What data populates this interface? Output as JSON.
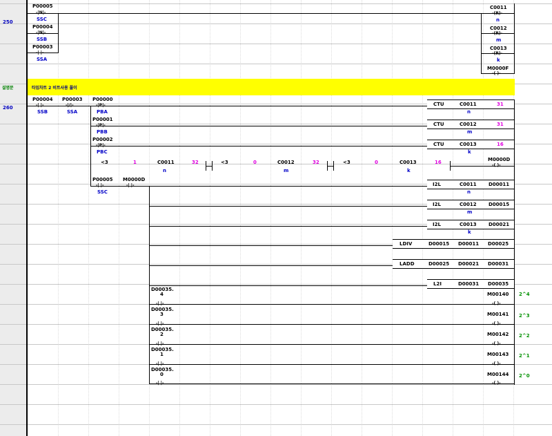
{
  "gutter": {
    "step_250": "250",
    "step_260": "260",
    "comment_tag": "설명문"
  },
  "comment_text": "타임차트 2 비트사용 풀이",
  "rung250": {
    "contacts": [
      {
        "addr": "P00005",
        "sym": "-|N|-",
        "dev": "SSC"
      },
      {
        "addr": "P00004",
        "sym": "-|N|-",
        "dev": "SSB"
      },
      {
        "addr": "P00003",
        "sym": "-| |-",
        "dev": "SSA"
      }
    ],
    "coils": [
      {
        "addr": "C0011",
        "sym": "-(R)-",
        "dev": "n"
      },
      {
        "addr": "C0012",
        "sym": "-(R)-",
        "dev": "m"
      },
      {
        "addr": "C0013",
        "sym": "-(R)-",
        "dev": "k"
      },
      {
        "addr": "M0000F",
        "sym": "-( )-",
        "dev": ""
      }
    ]
  },
  "rung260": {
    "c1": {
      "addr": "P00004",
      "sym": "-| |-",
      "dev": "SSB"
    },
    "c2": {
      "addr": "P00003",
      "sym": "-|/|-",
      "dev": "SSA"
    },
    "p1": {
      "addr": "P00000",
      "sym": "-|P|-",
      "dev": "PBA"
    },
    "p2": {
      "addr": "P00001",
      "sym": "-|P|-",
      "dev": "PBB"
    },
    "p3": {
      "addr": "P00002",
      "sym": "-|P|-",
      "dev": "PBC"
    },
    "ctu": [
      {
        "op": "CTU",
        "dev": "C0011",
        "val": "31",
        "sub": "n"
      },
      {
        "op": "CTU",
        "dev": "C0012",
        "val": "31",
        "sub": "m"
      },
      {
        "op": "CTU",
        "dev": "C0013",
        "val": "16",
        "sub": "k"
      }
    ],
    "cmp": {
      "a_op": "<3",
      "a_min": "1",
      "a_dev": "C0011",
      "a_sub": "n",
      "a_max": "32",
      "b_op": "<3",
      "b_min": "0",
      "b_dev": "C0012",
      "b_sub": "m",
      "b_max": "32",
      "c_op": "<3",
      "c_min": "0",
      "c_dev": "C0013",
      "c_sub": "k",
      "c_max": "16",
      "coil": "M0000D",
      "coil_sym": "-( )-"
    },
    "c5": {
      "addr": "P00005",
      "sym": "-| |-",
      "dev": "SSC"
    },
    "c6": {
      "addr": "M0000D",
      "sym": "-| |-",
      "dev": ""
    },
    "instr": [
      {
        "op": "I2L",
        "a": "C0011",
        "b": "D00011",
        "sub": "n"
      },
      {
        "op": "I2L",
        "a": "C0012",
        "b": "D00015",
        "sub": "m"
      },
      {
        "op": "I2L",
        "a": "C0013",
        "b": "D00021",
        "sub": "k"
      },
      {
        "op": "LDIV",
        "a": "D00015",
        "b": "D00011",
        "c": "D00025"
      },
      {
        "op": "LADD",
        "a": "D00025",
        "b": "D00021",
        "c": "D00031"
      },
      {
        "op": "L2I",
        "a": "D00031",
        "b": "D00035"
      }
    ],
    "bits": [
      {
        "addr": "D00035.",
        "bit": "4",
        "sym": "-| |-",
        "coil": "M00140",
        "coil_sym": "-( )-",
        "note": "2^4"
      },
      {
        "addr": "D00035.",
        "bit": "3",
        "sym": "-| |-",
        "coil": "M00141",
        "coil_sym": "-( )-",
        "note": "2^3"
      },
      {
        "addr": "D00035.",
        "bit": "2",
        "sym": "-| |-",
        "coil": "M00142",
        "coil_sym": "-( )-",
        "note": "2^2"
      },
      {
        "addr": "D00035.",
        "bit": "1",
        "sym": "-| |-",
        "coil": "M00143",
        "coil_sym": "-( )-",
        "note": "2^1"
      },
      {
        "addr": "D00035.",
        "bit": "0",
        "sym": "-| |-",
        "coil": "M00144",
        "coil_sym": "-( )-",
        "note": "2^0"
      }
    ]
  }
}
